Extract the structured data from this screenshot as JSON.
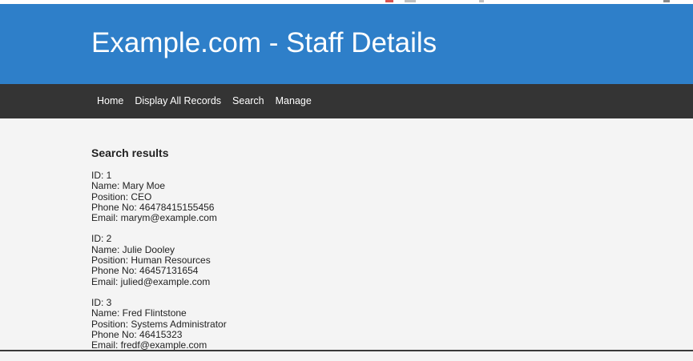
{
  "site": {
    "title": "Example.com - Staff Details"
  },
  "nav": {
    "items": [
      {
        "label": "Home"
      },
      {
        "label": "Display All Records"
      },
      {
        "label": "Search"
      },
      {
        "label": "Manage"
      }
    ]
  },
  "results": {
    "heading": "Search results",
    "records": [
      {
        "id": "ID: 1",
        "name": "Name: Mary Moe",
        "position": "Position: CEO",
        "phone": "Phone No: 46478415155456",
        "email": "Email: marym@example.com"
      },
      {
        "id": "ID: 2",
        "name": "Name: Julie Dooley",
        "position": "Position: Human Resources",
        "phone": "Phone No: 46457131654",
        "email": "Email: julied@example.com"
      },
      {
        "id": "ID: 3",
        "name": "Name: Fred Flintstone",
        "position": "Position: Systems Administrator",
        "phone": "Phone No: 46415323",
        "email": "Email: fredf@example.com"
      }
    ]
  },
  "colors": {
    "header_bg": "#2e7fc9",
    "nav_bg": "#343434",
    "page_bg": "#f4f4f4"
  }
}
